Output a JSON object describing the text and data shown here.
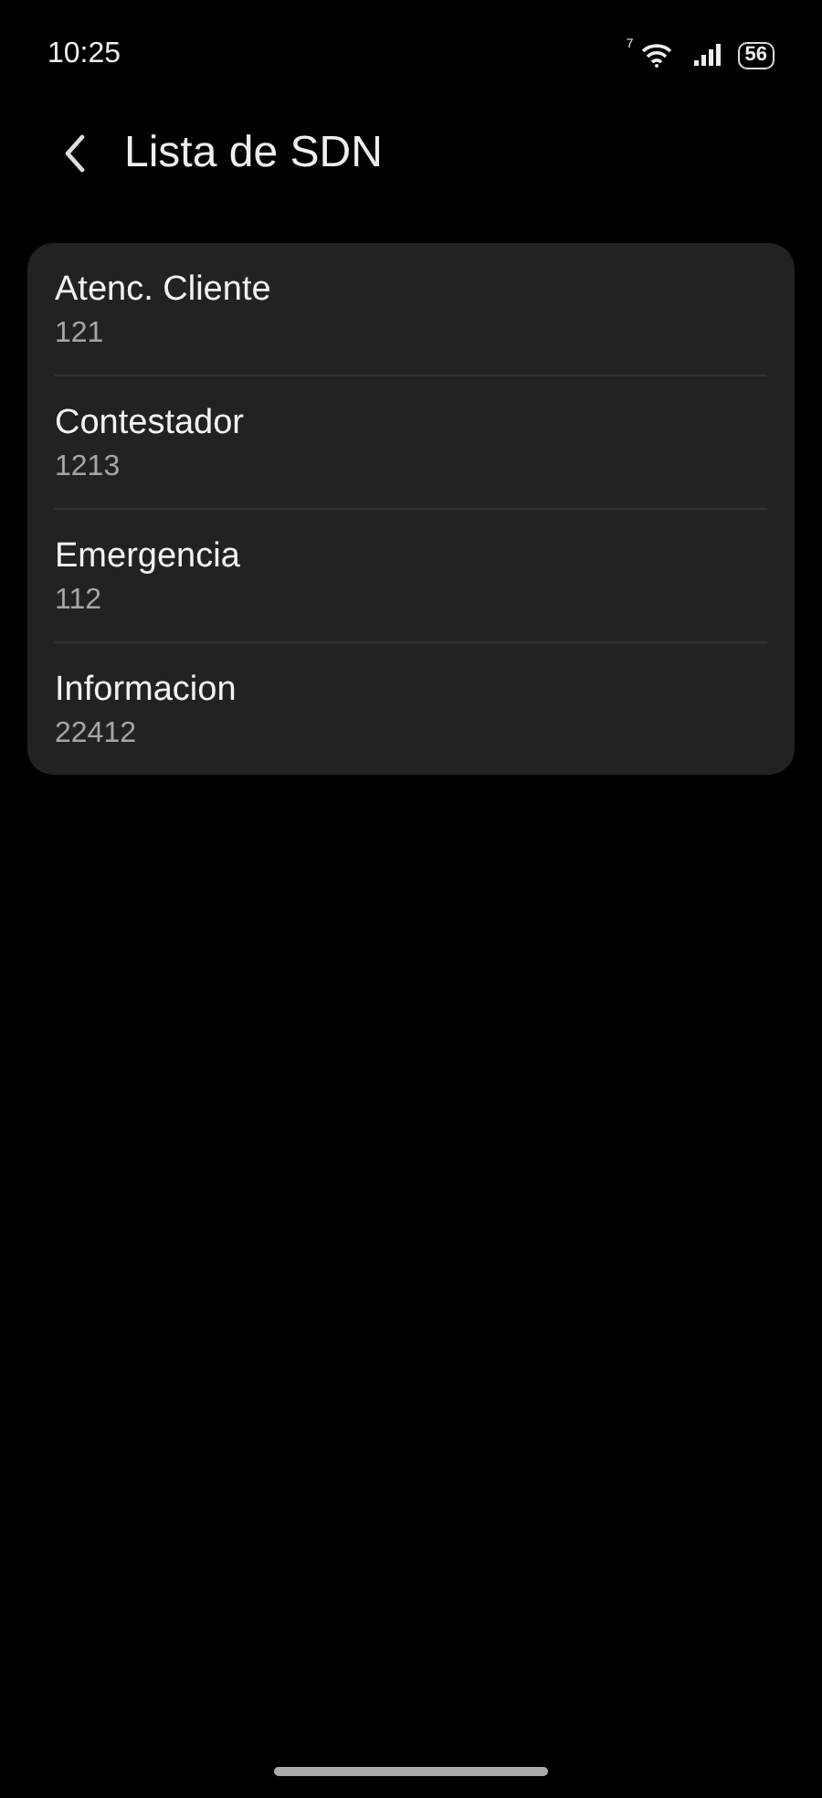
{
  "status_bar": {
    "time": "10:25",
    "wifi_badge": "7",
    "battery": "56"
  },
  "header": {
    "title": "Lista de SDN"
  },
  "entries": [
    {
      "name": "Atenc. Cliente",
      "number": "121"
    },
    {
      "name": "Contestador",
      "number": "1213"
    },
    {
      "name": "Emergencia",
      "number": "112"
    },
    {
      "name": "Informacion",
      "number": "22412"
    }
  ]
}
